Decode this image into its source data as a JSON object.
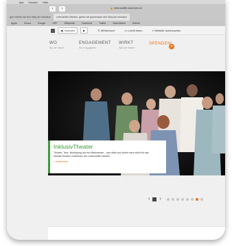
{
  "menubar": {
    "items": [
      "atei",
      "Fenster",
      "Hilfe"
    ]
  },
  "browser": {
    "address": "lebenshilfe-kaernten.at",
    "tabs": [
      "gen erleben auf den Weg der Inklusion",
      "Lebenshilfe Kärnten, gehen wir gemeinsam den Weg der Inklusion"
    ],
    "bookmarks_left": [
      "Apple",
      "iCloud",
      "Google",
      "ORF",
      "Wikipedia",
      "Facebook",
      "Twitter",
      "Nachrichten",
      "Beliebt"
    ],
    "bookmarks_right": [
      "Lebenshilfe Kärnten, gehen wir gemeinsam den Weg der Inklusion"
    ]
  },
  "toolbar": {
    "listen_label": "Vorlesen",
    "play_symbol": "▶",
    "dictionary_label": "Wörterbuch",
    "easy_read_label": "Leicht lesen",
    "search_label": "Website durchsuchen"
  },
  "site_nav": {
    "items": [
      {
        "title": "WO",
        "subtitle": "Wo wir wirken"
      },
      {
        "title": "ENGAGEMENT",
        "subtitle": "Sich engagieren"
      },
      {
        "title": "WIRKT",
        "subtitle": "Was wir wirken"
      }
    ],
    "donate_label": "SPENDEN!"
  },
  "hero": {
    "title": "InklusivTheater",
    "description": "Theater, Tanz, Bewegung und ein Miteinander – das alles und vieles mehr steht für das InklusivTheater Ledenitzen der Lebenshilfe Kärnten.",
    "link_label": "> weiterlesen"
  },
  "slider": {
    "prev_symbol": "‹",
    "next_symbol": "›",
    "slide_count": 8,
    "active_slide": 6
  },
  "colors": {
    "accent_green": "#3d9a3a",
    "accent_orange": "#e8731d",
    "page_bg": "#f0f0f0"
  }
}
